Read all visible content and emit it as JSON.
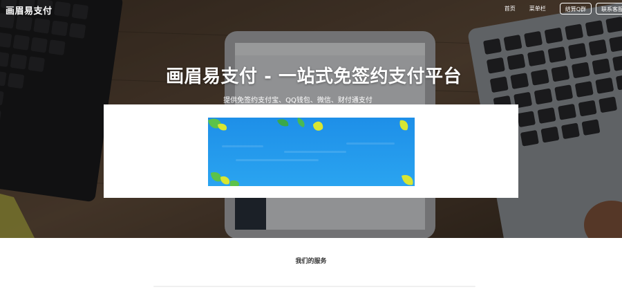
{
  "navbar": {
    "brand": "画眉易支付",
    "links": [
      "首页",
      "菜单栏"
    ],
    "buttons": [
      "结算Q群",
      "联系客服"
    ]
  },
  "hero": {
    "title": "画眉易支付 - 一站式免签约支付平台",
    "subtitle": "提供免签约支付宝、QQ钱包、微信、财付通支付"
  },
  "services": {
    "title": "我们的服务"
  },
  "colors": {
    "banner_sky": "#1e90e6",
    "leaf": "#d8e632",
    "hero_bg": "#3a2e24"
  }
}
